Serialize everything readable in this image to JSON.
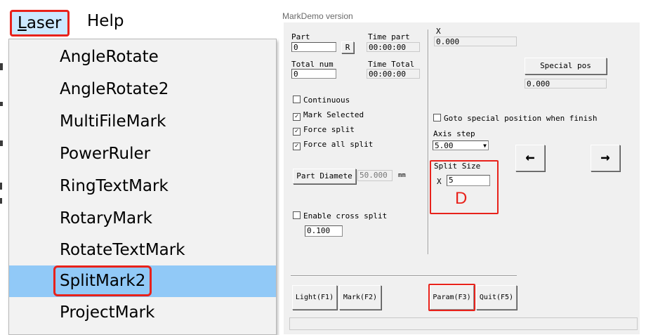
{
  "menubar": {
    "laser_rest": "aser",
    "laser_first": "L",
    "help": "Help"
  },
  "menu": {
    "items": [
      "AngleRotate",
      "AngleRotate2",
      "MultiFileMark",
      "PowerRuler",
      "RingTextMark",
      "RotaryMark",
      "RotateTextMark",
      "SplitMark2",
      "ProjectMark"
    ],
    "selected_index": 7
  },
  "dialog": {
    "title": "MarkDemo version",
    "part_label": "Part",
    "part_value": "0",
    "r_button": "R",
    "time_part_label": "Time part",
    "time_part_value": "00:00:00",
    "total_num_label": "Total num",
    "total_num_value": "0",
    "time_total_label": "Time Total",
    "time_total_value": "00:00:00",
    "x_label": "X",
    "x_value": "0.000",
    "special_pos_button": "Special pos",
    "special_pos_value": "0.000",
    "continuous": "Continuous",
    "mark_selected": "Mark Selected",
    "force_split": "Force split",
    "force_all_split": "Force all split",
    "goto_special": "Goto special position when finish",
    "axis_step_label": "Axis step",
    "axis_step_value": "5.00",
    "left_arrow": "←",
    "right_arrow": "→",
    "part_diameter_button": "Part Diamete",
    "part_diameter_value": "50.000",
    "mm": "mm",
    "split_size_label": "Split Size",
    "split_x_label": "X",
    "split_x_value": "5",
    "annotation_d": "D",
    "enable_cross_split": "Enable cross split",
    "cross_value": "0.100",
    "light_button": "Light(F1)",
    "mark_button": "Mark(F2)",
    "param_button": "Param(F3)",
    "quit_button": "Quit(F5)"
  },
  "colors": {
    "highlight_red": "#e8221b",
    "selection_blue": "#91c9f7",
    "menubar_hover": "#cce8ff"
  }
}
